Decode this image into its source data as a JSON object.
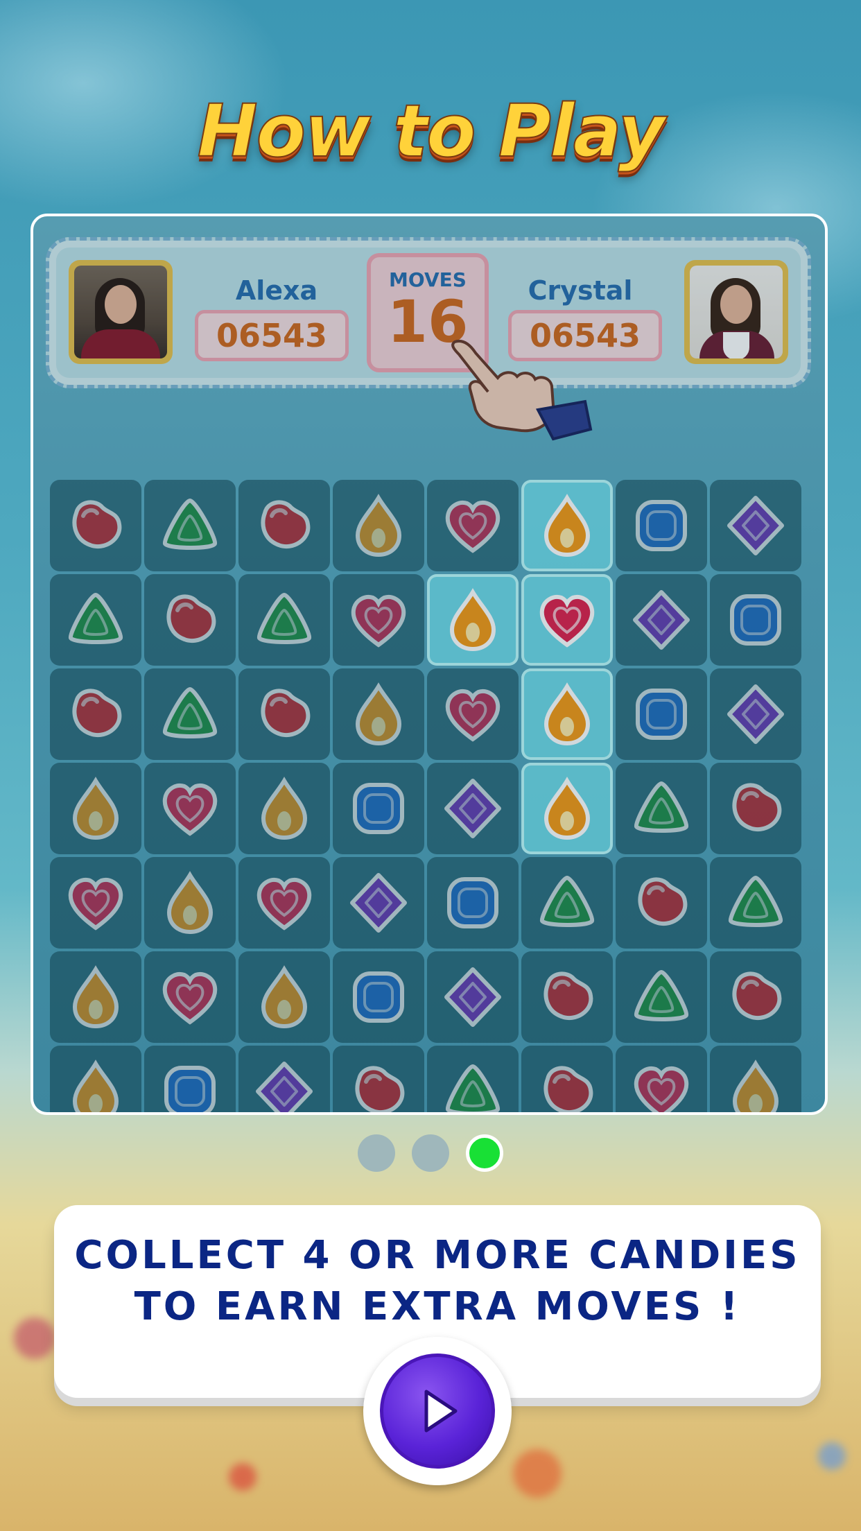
{
  "title": "How to Play",
  "players": {
    "left": {
      "name": "Alexa",
      "score": "06543"
    },
    "right": {
      "name": "Crystal",
      "score": "06543"
    }
  },
  "moves": {
    "label": "MOVES",
    "value": "16"
  },
  "board": {
    "rows": [
      [
        "bean",
        "triangle",
        "bean",
        "drop",
        "heart",
        "drop",
        "square",
        "diamond"
      ],
      [
        "triangle",
        "bean",
        "triangle",
        "heart",
        "drop",
        "heart",
        "diamond",
        "square"
      ],
      [
        "bean",
        "triangle",
        "bean",
        "drop",
        "heart",
        "drop",
        "square",
        "diamond"
      ],
      [
        "drop",
        "heart",
        "drop",
        "square",
        "diamond",
        "drop",
        "triangle",
        "bean"
      ],
      [
        "heart",
        "drop",
        "heart",
        "diamond",
        "square",
        "triangle",
        "bean",
        "triangle"
      ],
      [
        "drop",
        "heart",
        "drop",
        "square",
        "diamond",
        "bean",
        "triangle",
        "bean"
      ],
      [
        "drop",
        "square",
        "diamond",
        "bean",
        "triangle",
        "bean",
        "heart",
        "drop"
      ]
    ],
    "highlighted": [
      [
        0,
        5
      ],
      [
        1,
        4
      ],
      [
        1,
        5
      ],
      [
        2,
        5
      ],
      [
        3,
        5
      ]
    ],
    "colors": {
      "bean": "#d8242c",
      "triangle": "#1f9a3c",
      "drop": "#f59a16",
      "heart": "#e0234e",
      "square": "#1f6fd6",
      "diamond": "#7a2fc4"
    }
  },
  "pagination": {
    "total": 3,
    "active": 3
  },
  "instruction": {
    "line1": "COLLECT 4 OR MORE CANDIES",
    "line2": "TO EARN EXTRA MOVES !"
  },
  "play_button": {
    "icon": "play-icon"
  }
}
